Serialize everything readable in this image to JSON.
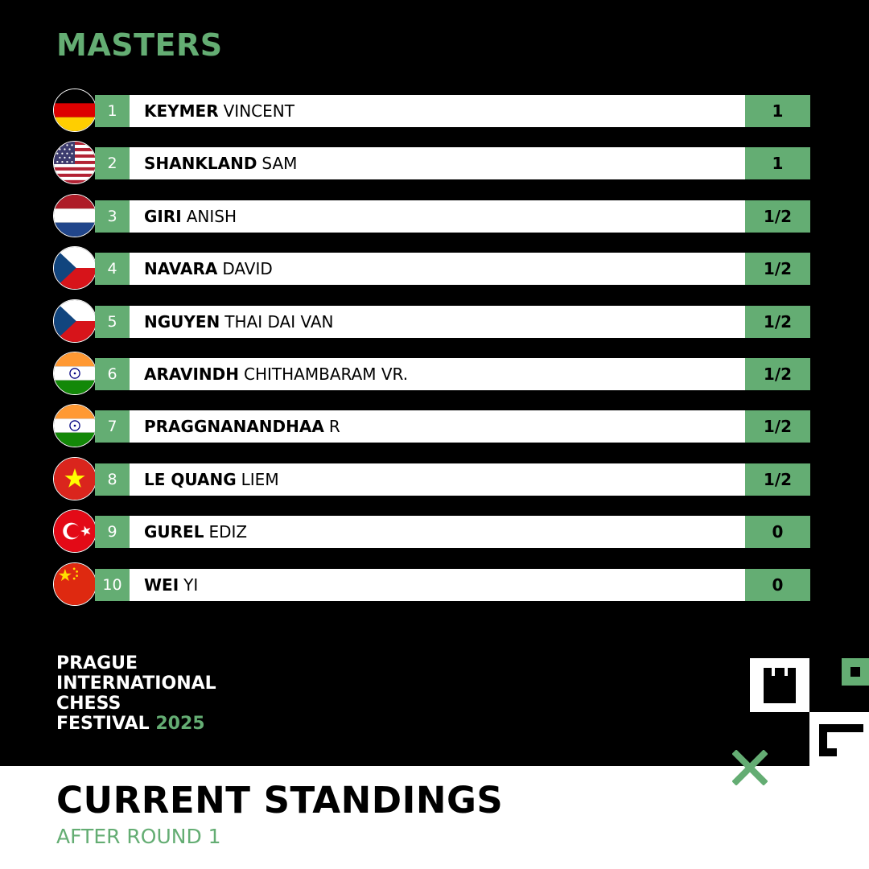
{
  "section_title": "MASTERS",
  "standings": [
    {
      "rank": "1",
      "last": "KEYMER",
      "first": "VINCENT",
      "score": "1",
      "flag": "germany-flag-icon"
    },
    {
      "rank": "2",
      "last": "SHANKLAND",
      "first": "SAM",
      "score": "1",
      "flag": "usa-flag-icon"
    },
    {
      "rank": "3",
      "last": "GIRI",
      "first": "ANISH",
      "score": "1/2",
      "flag": "netherlands-flag-icon"
    },
    {
      "rank": "4",
      "last": "NAVARA",
      "first": "DAVID",
      "score": "1/2",
      "flag": "czech-flag-icon"
    },
    {
      "rank": "5",
      "last": "NGUYEN",
      "first": "THAI DAI VAN",
      "score": "1/2",
      "flag": "czech-flag-icon"
    },
    {
      "rank": "6",
      "last": "ARAVINDH",
      "first": "CHITHAMBARAM VR.",
      "score": "1/2",
      "flag": "india-flag-icon"
    },
    {
      "rank": "7",
      "last": "PRAGGNANANDHAA",
      "first": "R",
      "score": "1/2",
      "flag": "india-flag-icon"
    },
    {
      "rank": "8",
      "last": "LE QUANG",
      "first": "LIEM",
      "score": "1/2",
      "flag": "vietnam-flag-icon"
    },
    {
      "rank": "9",
      "last": "GUREL",
      "first": "EDIZ",
      "score": "0",
      "flag": "turkey-flag-icon"
    },
    {
      "rank": "10",
      "last": "WEI",
      "first": "YI",
      "score": "0",
      "flag": "china-flag-icon"
    }
  ],
  "festival": {
    "line1": "PRAGUE",
    "line2": "INTERNATIONAL",
    "line3": "CHESS",
    "line4": "FESTIVAL",
    "year": "2025"
  },
  "footer": {
    "heading": "CURRENT STANDINGS",
    "subheading": "AFTER ROUND 1"
  },
  "colors": {
    "accent": "#64ad73",
    "background": "#000000",
    "panel": "#ffffff"
  }
}
